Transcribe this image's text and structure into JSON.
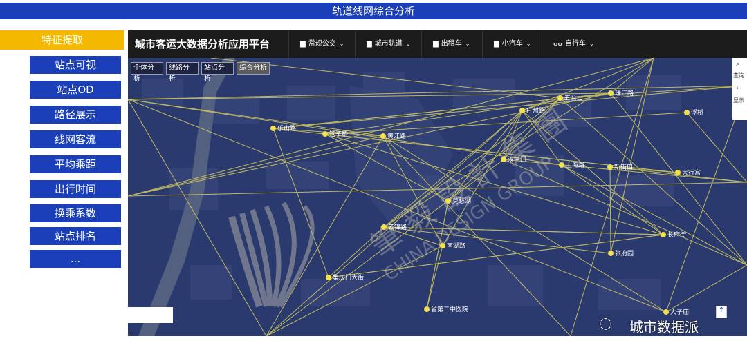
{
  "banner": {
    "title": "轨道线网综合分析"
  },
  "sidebar": {
    "header": "特征提取",
    "items": [
      "站点可视",
      "站点OD",
      "路径展示",
      "线网客流",
      "平均乘距",
      "出行时间",
      "换乘系数",
      "站点排名",
      "..."
    ]
  },
  "app": {
    "title": "城市客运大数据分析应用平台",
    "nav": [
      {
        "icon": "bus-icon",
        "label": "常规公交"
      },
      {
        "icon": "metro-icon",
        "label": "城市轨道"
      },
      {
        "icon": "taxi-icon",
        "label": "出租车"
      },
      {
        "icon": "car-icon",
        "label": "小汽车"
      },
      {
        "icon": "bike-icon",
        "label": "自行车"
      }
    ],
    "subtabs": [
      "个体分析",
      "线路分析",
      "站点分析",
      "综合分析"
    ],
    "active_subtab": "综合分析",
    "tools": [
      "查询",
      "显示"
    ]
  },
  "map": {
    "stations": [
      "乐山路",
      "管子桥",
      "黄江路",
      "五台山",
      "珠江路",
      "浮桥",
      "广州路",
      "汉中门",
      "上海路",
      "新街口",
      "大行宫",
      "莫愁湖",
      "云锦路",
      "南湖路",
      "长府街",
      "张府园",
      "集庆门大街",
      "省第二中医院",
      "大子庙"
    ],
    "watermark": {
      "cn": "筆 毅 設 計 集 團",
      "en": "CHINA DESIGN GROUP"
    }
  },
  "credit": "城市数据派",
  "colors": {
    "banner": "#1a3fb8",
    "accent": "#f5b800",
    "map_bg": "#2b3a6e",
    "route": "#d9d060",
    "station": "#f2e14a"
  }
}
